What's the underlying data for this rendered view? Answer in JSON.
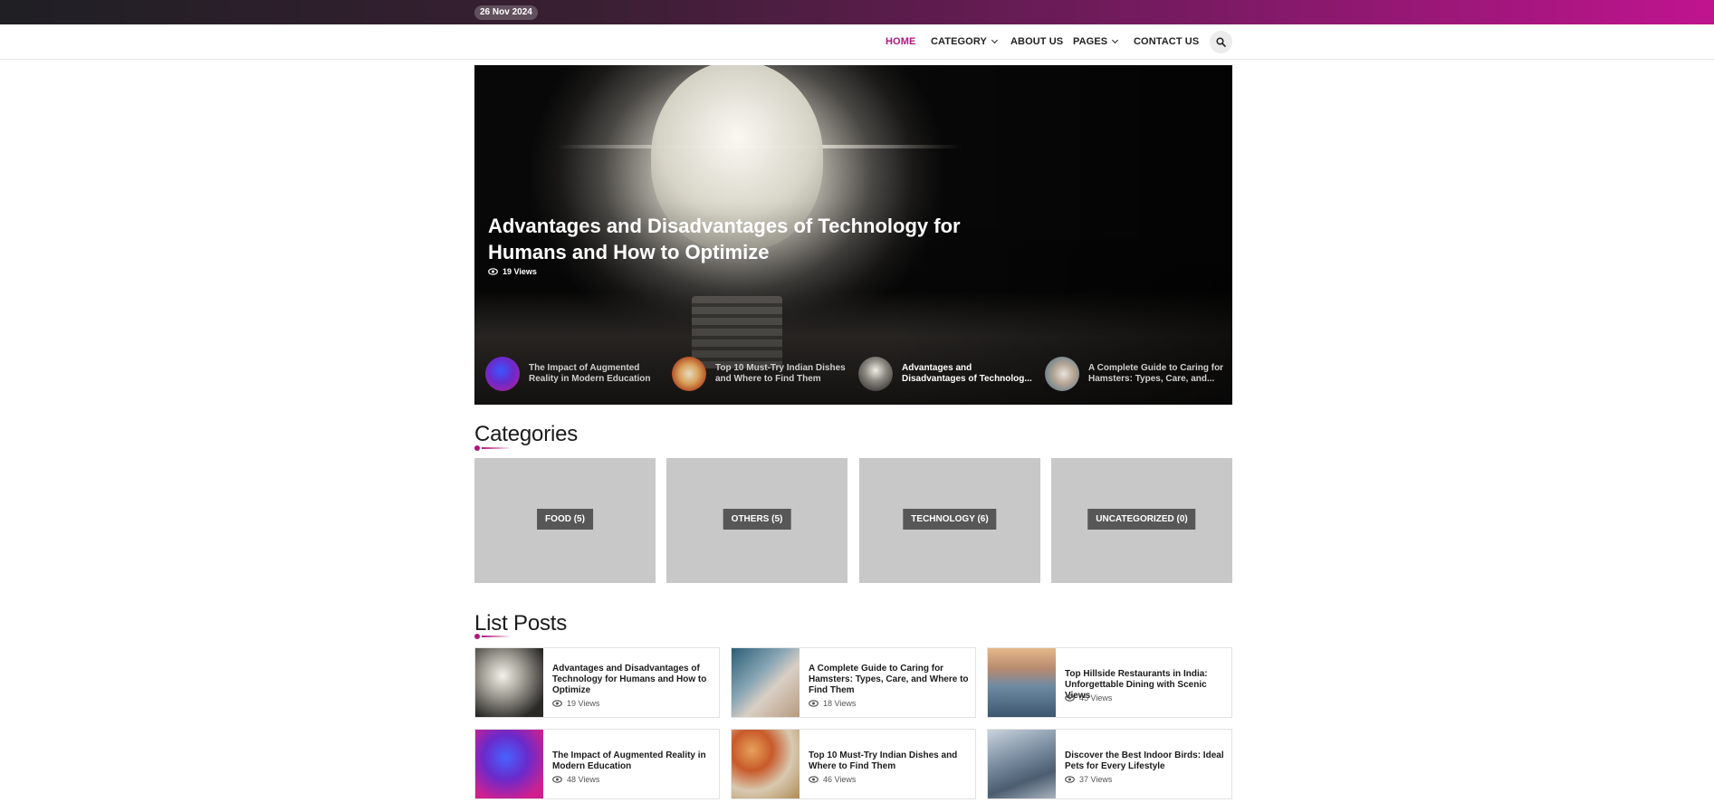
{
  "topbar": {
    "date": "26 Nov 2024"
  },
  "nav": {
    "items": [
      {
        "label": "HOME"
      },
      {
        "label": "CATEGORY"
      },
      {
        "label": "ABOUT US"
      },
      {
        "label": "PAGES"
      },
      {
        "label": "CONTACT US"
      }
    ]
  },
  "hero": {
    "title": "Advantages and Disadvantages of Technology for Humans and How to Optimize",
    "views": "19 Views",
    "thumbs": [
      {
        "title": "The Impact of Augmented Reality in Modern Education"
      },
      {
        "title": "Top 10 Must-Try Indian Dishes and Where to Find Them"
      },
      {
        "title": "Advantages and Disadvantages of Technolog..."
      },
      {
        "title": "A Complete Guide to Caring for Hamsters: Types, Care, and..."
      }
    ]
  },
  "categories": {
    "heading": "Categories",
    "items": [
      {
        "label": "FOOD (5)"
      },
      {
        "label": "OTHERS (5)"
      },
      {
        "label": "TECHNOLOGY (6)"
      },
      {
        "label": "UNCATEGORIZED (0)"
      }
    ]
  },
  "list_posts": {
    "heading": "List Posts",
    "items": [
      {
        "title": "Advantages and Disadvantages of Technology for Humans and How to Optimize",
        "views": "19 Views"
      },
      {
        "title": "A Complete Guide to Caring for Hamsters: Types, Care, and Where to Find Them",
        "views": "18 Views"
      },
      {
        "title": "Top Hillside Restaurants in India: Unforgettable Dining with Scenic Views",
        "views": "45 Views"
      },
      {
        "title": "The Impact of Augmented Reality in Modern Education",
        "views": "48 Views"
      },
      {
        "title": "Top 10 Must-Try Indian Dishes and Where to Find Them",
        "views": "46 Views"
      },
      {
        "title": "Discover the Best Indoor Birds: Ideal Pets for Every Lifestyle",
        "views": "37 Views"
      }
    ]
  },
  "colors": {
    "accent": "#b3157f",
    "topbar_end": "#c0148f",
    "category_card": "#c8c8c8",
    "category_label": "#575757"
  },
  "icons": [
    "search-icon",
    "chevron-down-icon",
    "eye-icon"
  ]
}
